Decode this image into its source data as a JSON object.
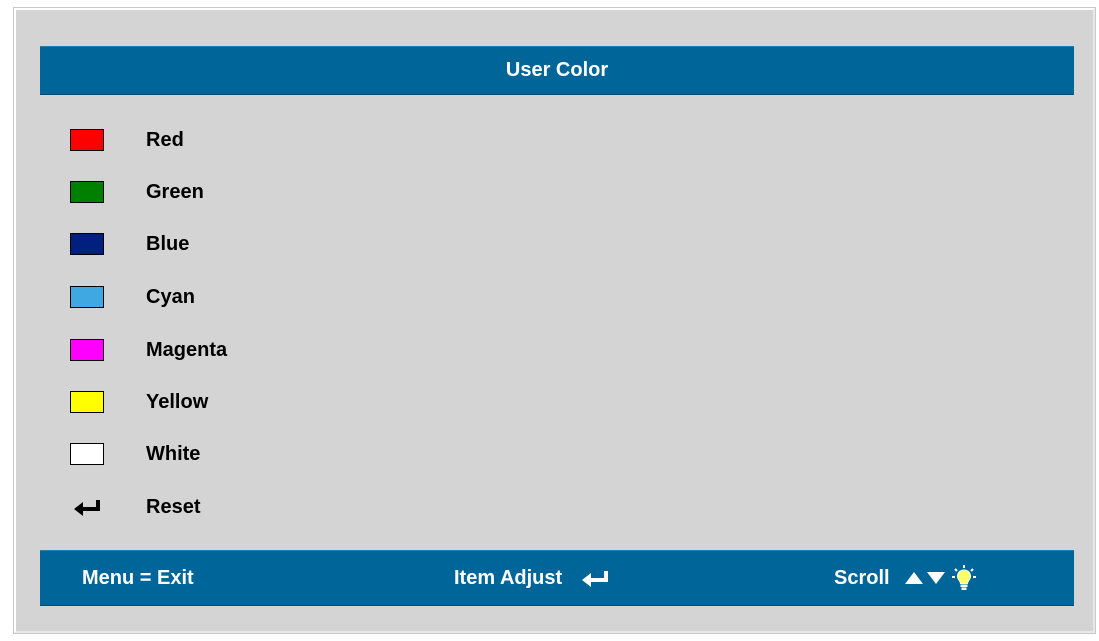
{
  "title": "User Color",
  "colors": {
    "header_bg": "#006699",
    "panel_bg": "#d4d4d4",
    "red": "#ff0000",
    "green": "#008000",
    "blue": "#002080",
    "cyan": "#40a8e0",
    "magenta": "#ff00ff",
    "yellow": "#ffff00",
    "white": "#ffffff"
  },
  "menu": {
    "items": [
      {
        "label": "Red",
        "icon": "red-swatch"
      },
      {
        "label": "Green",
        "icon": "green-swatch"
      },
      {
        "label": "Blue",
        "icon": "blue-swatch"
      },
      {
        "label": "Cyan",
        "icon": "cyan-swatch"
      },
      {
        "label": "Magenta",
        "icon": "magenta-swatch"
      },
      {
        "label": "Yellow",
        "icon": "yellow-swatch"
      },
      {
        "label": "White",
        "icon": "white-swatch"
      },
      {
        "label": "Reset",
        "icon": "enter-arrow-icon"
      }
    ]
  },
  "footer": {
    "exit_label": "Menu = Exit",
    "adjust_label": "Item Adjust",
    "scroll_label": "Scroll",
    "icons": [
      "enter-arrow-icon",
      "up-arrow-icon",
      "down-arrow-icon",
      "lightbulb-icon"
    ]
  }
}
